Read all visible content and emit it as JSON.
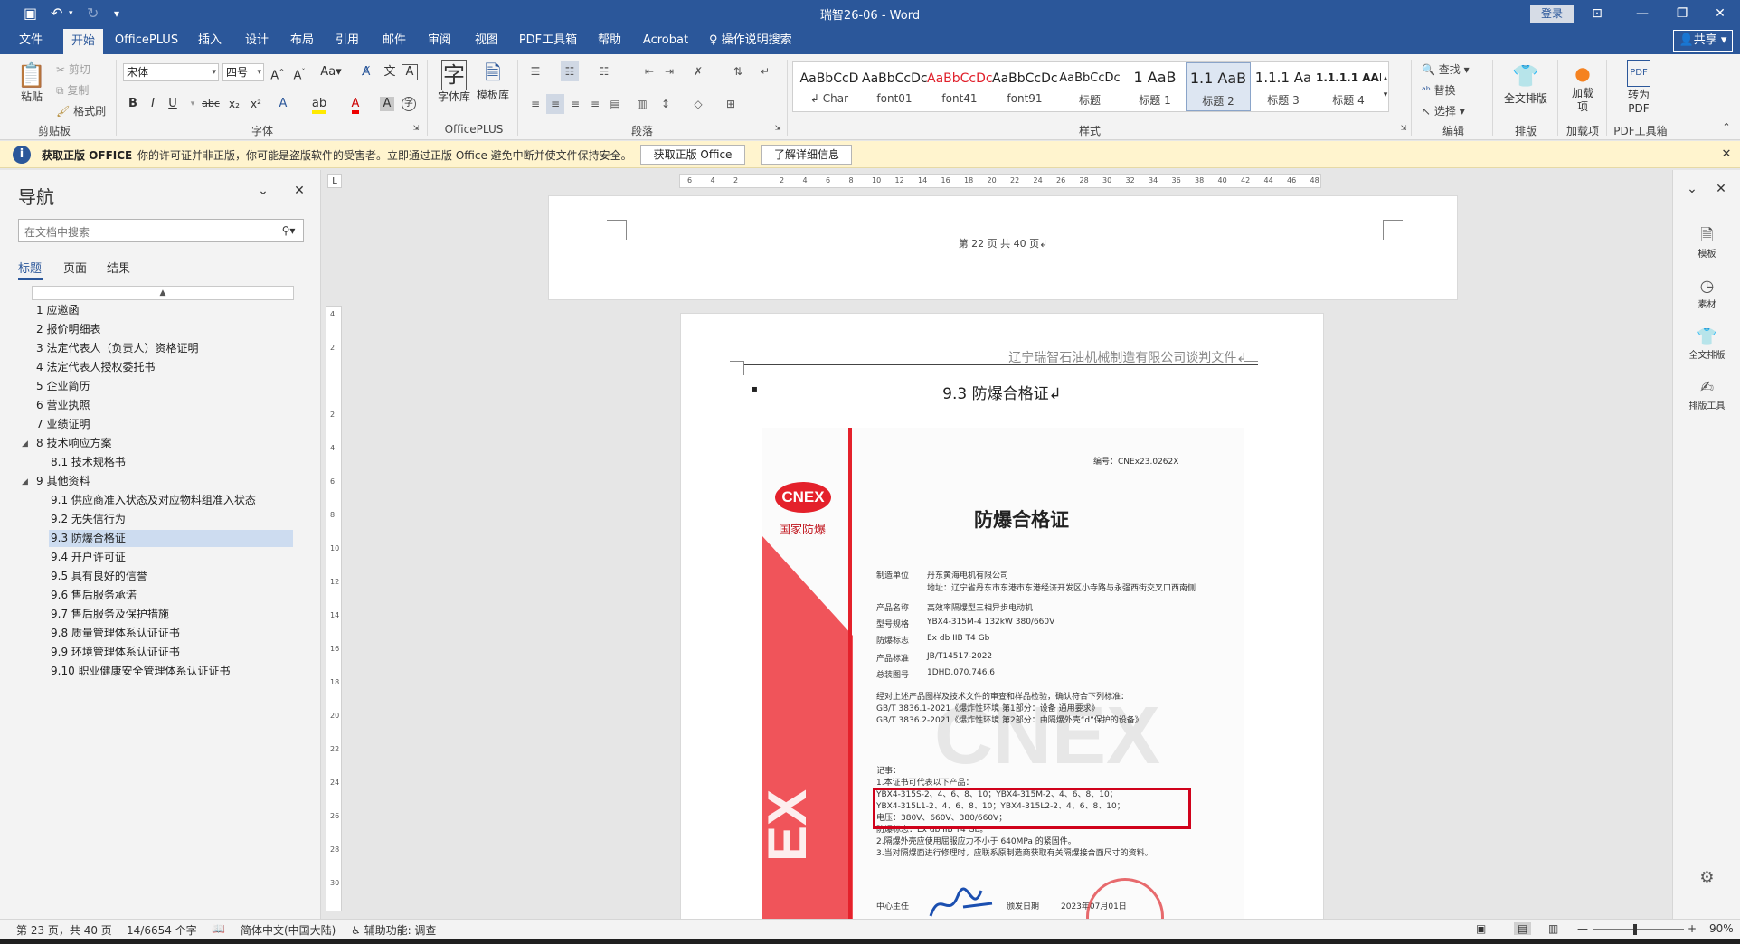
{
  "window": {
    "title": "瑞智26-06 - Word",
    "login": "登录"
  },
  "tabs": [
    "文件",
    "开始",
    "OfficePLUS",
    "插入",
    "设计",
    "布局",
    "引用",
    "邮件",
    "审阅",
    "视图",
    "PDF工具箱",
    "帮助",
    "Acrobat"
  ],
  "tell_me": "操作说明搜索",
  "share": "共享",
  "ribbon": {
    "clipboard": {
      "paste": "粘贴",
      "cut": "剪切",
      "copy": "复制",
      "format_painter": "格式刷",
      "label": "剪贴板"
    },
    "font": {
      "name": "宋体",
      "size": "四号",
      "label": "字体",
      "aa": "Aa",
      "bold": "B",
      "italic": "I",
      "underline": "U",
      "strike": "abc",
      "sub": "x₂",
      "sup": "x²"
    },
    "officeplus": {
      "font_lib": "字体库",
      "template_lib": "模板库",
      "label": "OfficePLUS"
    },
    "paragraph": {
      "label": "段落"
    },
    "styles": {
      "label": "样式",
      "items": [
        {
          "preview": "AaBbCcD",
          "name": "↲ Char"
        },
        {
          "preview": "AaBbCcDc",
          "name": "font01"
        },
        {
          "preview": "AaBbCcDc",
          "name": "font41"
        },
        {
          "preview": "AaBbCcDc",
          "name": "font91"
        },
        {
          "preview": "AaBbCcDc",
          "name": "标题"
        },
        {
          "preview": "1  AaB",
          "name": "标题 1"
        },
        {
          "preview": "1.1  AaB",
          "name": "标题 2"
        },
        {
          "preview": "1.1.1  Aa",
          "name": "标题 3"
        },
        {
          "preview": "1.1.1.1  AAE",
          "name": "标题 4"
        }
      ]
    },
    "editing": {
      "find": "查找",
      "replace": "替换",
      "select": "选择",
      "label": "编辑"
    },
    "layout": {
      "full_layout": "全文排版",
      "label": "排版"
    },
    "addins": {
      "load": "加载项",
      "label": "加载项"
    },
    "pdf": {
      "convert": "转为PDF",
      "label": "PDF工具箱"
    }
  },
  "infobar": {
    "title": "获取正版 OFFICE",
    "message": "你的许可证并非正版，你可能是盗版软件的受害者。立即通过正版 Office 避免中断并使文件保持安全。",
    "btn_get": "获取正版 Office",
    "btn_more": "了解详细信息"
  },
  "nav": {
    "title": "导航",
    "search_placeholder": "在文档中搜索",
    "tabs": [
      "标题",
      "页面",
      "结果"
    ],
    "items": [
      "1 应邀函",
      "2 报价明细表",
      "3 法定代表人（负责人）资格证明",
      "4 法定代表人授权委托书",
      "5 企业简历",
      "6 营业执照",
      "7 业绩证明",
      "8 技术响应方案",
      "8.1 技术规格书",
      "9 其他资料",
      "9.1 供应商准入状态及对应物料组准入状态",
      "9.2 无失信行为",
      "9.3 防爆合格证",
      "9.4 开户许可证",
      "9.5 具有良好的信誉",
      "9.6 售后服务承诺",
      "9.7 售后服务及保护措施",
      "9.8 质量管理体系认证证书",
      "9.9 环境管理体系认证证书",
      "9.10 职业健康安全管理体系认证证书"
    ]
  },
  "doc": {
    "page_footer": "第 22 页 共 40 页↲",
    "header_text": "辽宁瑞智石油机械制造有限公司谈判文件↲",
    "heading": "9.3  防爆合格证↲",
    "ruler_h": [
      "6",
      "4",
      "2",
      "",
      "2",
      "4",
      "6",
      "8",
      "10",
      "12",
      "14",
      "16",
      "18",
      "20",
      "22",
      "24",
      "26",
      "28",
      "30",
      "32",
      "34",
      "36",
      "38",
      "40",
      "42",
      "44",
      "46",
      "48"
    ],
    "ruler_v": [
      "4",
      "2",
      "",
      "2",
      "4",
      "6",
      "8",
      "10",
      "12",
      "14",
      "16",
      "18",
      "20",
      "22",
      "24",
      "26",
      "28",
      "30"
    ],
    "certificate": {
      "logo": "CNEX",
      "org": "国家防爆",
      "number": "编号：CNEx23.0262X",
      "title": "防爆合格证",
      "rows": [
        {
          "k": "制造单位",
          "v": "丹东黄海电机有限公司"
        },
        {
          "k": "",
          "v": "地址：辽宁省丹东市东港市东港经济开发区小寺路与永强西街交叉口西南侧"
        },
        {
          "k": "产品名称",
          "v": "高效率隔爆型三相异步电动机"
        },
        {
          "k": "型号规格",
          "v": "YBX4-315M-4      132kW      380/660V"
        },
        {
          "k": "防爆标志",
          "v": "Ex db IIB T4 Gb"
        },
        {
          "k": "产品标准",
          "v": "JB/T14517-2022"
        },
        {
          "k": "总装图号",
          "v": "1DHD.070.746.6"
        }
      ],
      "standards_intro": "经对上述产品图样及技术文件的审查和样品检验，确认符合下列标准：",
      "standards": [
        "GB/T 3836.1-2021《爆炸性环境 第1部分：设备 通用要求》",
        "GB/T 3836.2-2021《爆炸性环境 第2部分：由隔爆外壳“d”保护的设备》"
      ],
      "notes_title": "记事：",
      "notes": [
        "1.本证书可代表以下产品：",
        "  YBX4-315S-2、4、6、8、10；YBX4-315M-2、4、6、8、10；",
        "  YBX4-315L1-2、4、6、8、10；YBX4-315L2-2、4、6、8、10；",
        "  电压：380V、660V、380/660V；",
        "  防爆标志：Ex db IIB T4 Gb。",
        "2.隔爆外壳应使用屈服应力不小于 640MPa 的紧固件。",
        "3.当对隔爆面进行修理时，应联系原制造商获取有关隔爆接合面尺寸的资料。"
      ],
      "director": "中心主任",
      "issue_date_label": "颁发日期",
      "issue_date": "2023年07月01日",
      "watermark": "CNEX"
    }
  },
  "right_panel": [
    "模板",
    "素材",
    "全文排版",
    "排版工具"
  ],
  "status": {
    "page": "第 23 页，共 40 页",
    "words": "14/6654 个字",
    "lang": "简体中文(中国大陆)",
    "access": "辅助功能: 调查",
    "zoom": "90%"
  },
  "colors": {
    "accent": "#2b579a",
    "ribbon": "#f3f3f3",
    "infobar": "#fff4ce",
    "cnex_red": "#e4212b",
    "highlight_box": "#d0021b"
  }
}
